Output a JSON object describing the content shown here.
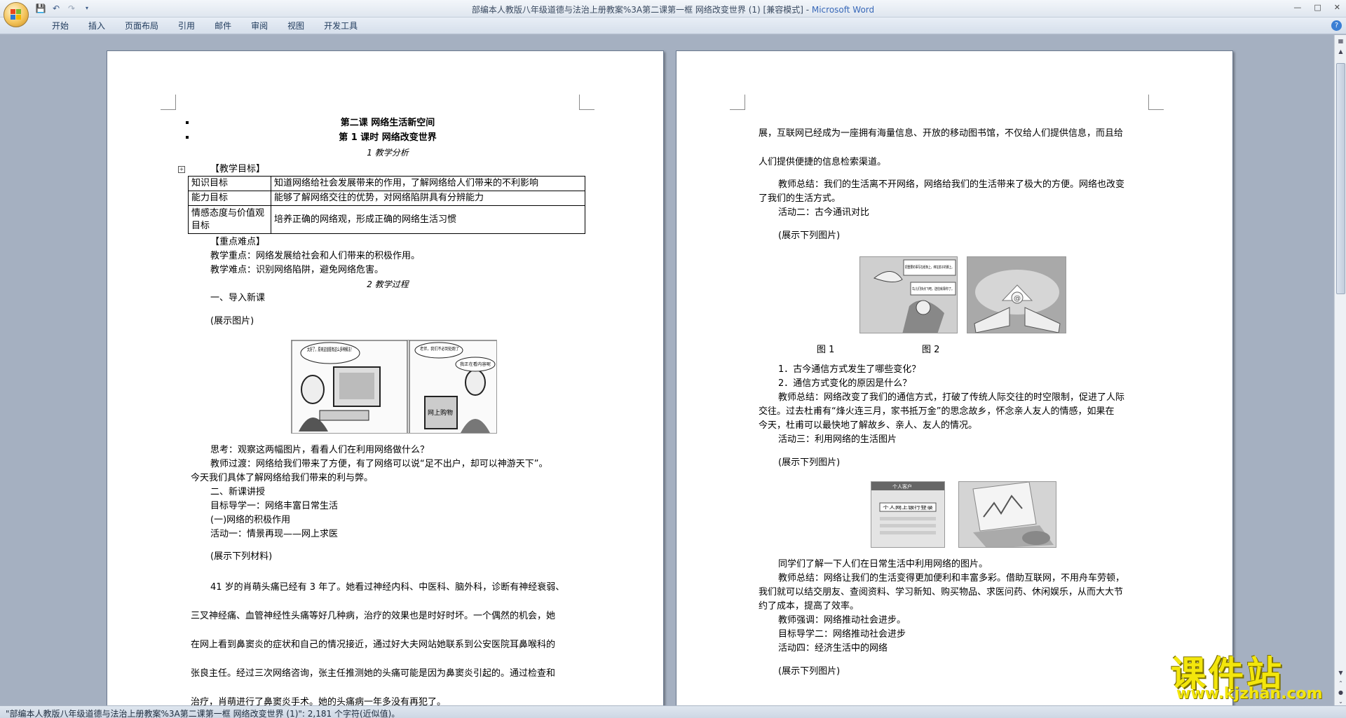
{
  "window": {
    "title_doc": "部编本人教版八年级道德与法治上册教案%3A第二课第一框    网络改变世界 (1) [兼容模式] - ",
    "title_app": "Microsoft Word"
  },
  "ribbon": {
    "tabs": [
      "开始",
      "插入",
      "页面布局",
      "引用",
      "邮件",
      "审阅",
      "视图",
      "开发工具"
    ]
  },
  "page1": {
    "title1": "第二课    网络生活新空间",
    "title2": "第 1 课时    网络改变世界",
    "section1": "1    教学分析",
    "goals_heading": "【教学目标】",
    "goals": [
      {
        "label": "知识目标",
        "text": "知道网络给社会发展带来的作用，了解网络给人们带来的不利影响"
      },
      {
        "label": "能力目标",
        "text": "能够了解网络交往的优势，对网络陷阱具有分辨能力"
      },
      {
        "label": "情感态度与价值观目标",
        "text": "培养正确的网络观，形成正确的网络生活习惯"
      }
    ],
    "key_heading": "【重点难点】",
    "key_point": "教学重点：网络发展给社会和人们带来的积极作用。",
    "difficult_point": "教学难点：识别网络陷阱，避免网络危害。",
    "section2": "2    教学过程",
    "intro": "一、导入新课",
    "show_pic": "(展示图片)",
    "think": "思考：观察这两幅图片，看看人们在利用网络做什么？",
    "transition1": "教师过渡：网络给我们带来了方便，有了网络可以说“足不出户，却可以神游天下”。",
    "transition2": "今天我们具体了解网络给我们带来的利与弊。",
    "new_lesson": "二、新课讲授",
    "guide1": "目标导学一：网络丰富日常生活",
    "positive": "(一)网络的积极作用",
    "activity1": "活动一：情景再现——网上求医",
    "show_material": "(展示下列材料)",
    "story": [
      "41 岁的肖萌头痛已经有 3 年了。她看过神经内科、中医科、脑外科，诊断有神经衰弱、",
      "三叉神经痛、血管神经性头痛等好几种病，治疗的效果也是时好时坏。一个偶然的机会，她",
      "在网上看到鼻窦炎的症状和自己的情况接近，通过好大夫网站她联系到公安医院耳鼻喉科的",
      "张良主任。经过三次网络咨询，张主任推测她的头痛可能是因为鼻窦炎引起的。通过检查和",
      "治疗，肖萌进行了鼻窦炎手术。她的头痛病一年多没有再犯了。"
    ],
    "cartoon_text1": "太好了，原来这道题有这么多种解法！",
    "cartoon_text2": "老伴，我们不必到处跑了",
    "cartoon_text3": "我正在看内容呢",
    "cartoon_sign": "网上购物"
  },
  "page2": {
    "line1": "展，互联网已经成为一座拥有海量信息、开放的移动图书馆，不仅给人们提供信息，而且给",
    "line2": "人们提供便捷的信息检索渠道。",
    "summary1a": "教师总结：我们的生活离不开网络，网络给我们的生活带来了极大的方便。网络也改变",
    "summary1b": "了我们的生活方式。",
    "activity2": "活动二：古今通讯对比",
    "show_pic": "(展示下列图片)",
    "fig1": "图 1",
    "fig2": "图 2",
    "q1": "1．古今通信方式发生了哪些变化？",
    "q2": "2．通信方式变化的原因是什么？",
    "summary2a": "教师总结：网络改变了我们的通信方式，打破了传统人际交往的时空限制，促进了人际",
    "summary2b": "交往。过去杜甫有“烽火连三月，家书抵万金”的思念故乡，怀念亲人友人的情感，如果在",
    "summary2c": "今天，杜甫可以最快地了解故乡、亲人、友人的情况。",
    "activity3": "活动三：利用网络的生活图片",
    "show_pic2": "(展示下列图片)",
    "students": "同学们了解一下人们在日常生活中利用网络的图片。",
    "summary3a": "教师总结：网络让我们的生活变得更加便利和丰富多彩。借助互联网，不用舟车劳顿，",
    "summary3b": "我们就可以结交朋友、查阅资料、学习新知、购买物品、求医问药、休闲娱乐，从而大大节",
    "summary3c": "约了成本，提高了效率。",
    "emphasis": "教师强调：网络推动社会进步。",
    "guide2": "目标导学二：网络推动社会进步",
    "activity4": "活动四：经济生活中的网络",
    "show_pic3": "(展示下列图片)",
    "bird_text1": "把重要的事写在纸条上，绑在鸽子的脚上。",
    "bird_text2": "鸟儿们快点飞吧，送信就靠你了。",
    "bank_header": "个人客户",
    "bank_button": "个人网上银行登录"
  },
  "status": {
    "text": "\"部编本人教版八年级道德与法治上册教案%3A第二课第一框    网络改变世界 (1)\": 2,181 个字符(近似值)。"
  },
  "watermark": {
    "big": "课件站",
    "url": "www.kjzhan.com"
  }
}
